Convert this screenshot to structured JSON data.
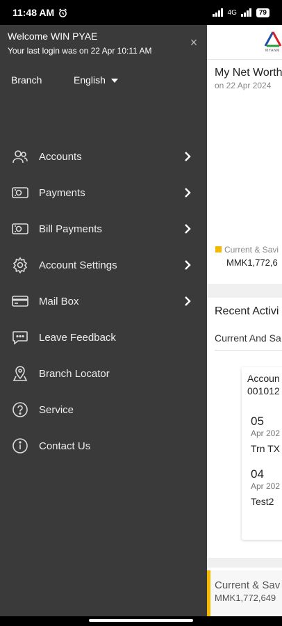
{
  "status": {
    "time": "11:48 AM",
    "battery": "79",
    "signal": "4G"
  },
  "drawer": {
    "welcome": "Welcome WIN PYAE",
    "last_login": "Your last login was on 22 Apr 10:11 AM",
    "close": "×",
    "branch_label": "Branch",
    "language": "English",
    "menu": [
      {
        "label": "Accounts",
        "icon": "users-icon",
        "has_chevron": true
      },
      {
        "label": "Payments",
        "icon": "cash-icon",
        "has_chevron": true
      },
      {
        "label": "Bill Payments",
        "icon": "bill-cash-icon",
        "has_chevron": true
      },
      {
        "label": "Account Settings",
        "icon": "gear-icon",
        "has_chevron": true
      },
      {
        "label": "Mail Box",
        "icon": "card-icon",
        "has_chevron": true
      },
      {
        "label": "Leave Feedback",
        "icon": "chat-bubble-icon",
        "has_chevron": false
      },
      {
        "label": "Branch Locator",
        "icon": "location-pin-icon",
        "has_chevron": false
      },
      {
        "label": "Service",
        "icon": "question-circle-icon",
        "has_chevron": false
      },
      {
        "label": "Contact Us",
        "icon": "info-circle-icon",
        "has_chevron": false
      }
    ]
  },
  "background": {
    "logo_text": "MYANM",
    "networth_title": "My Net Worth",
    "networth_date": "on 22 Apr 2024",
    "legend_label": "Current & Savi",
    "legend_value": "MMK1,772,6",
    "recent_title": "Recent Activi",
    "recent_tab": "Current And Sa",
    "account_label": "Accoun",
    "account_no": "001012",
    "transactions": [
      {
        "day": "05",
        "month": "Apr 202",
        "desc": "Trn TX"
      },
      {
        "day": "04",
        "month": "Apr 202",
        "desc": "Test2"
      }
    ],
    "bottom_label": "Current & Sav",
    "bottom_value": "MMK1,772,649"
  },
  "colors": {
    "drawer_bg": "#3a3a3a",
    "accent": "#f5b800"
  }
}
